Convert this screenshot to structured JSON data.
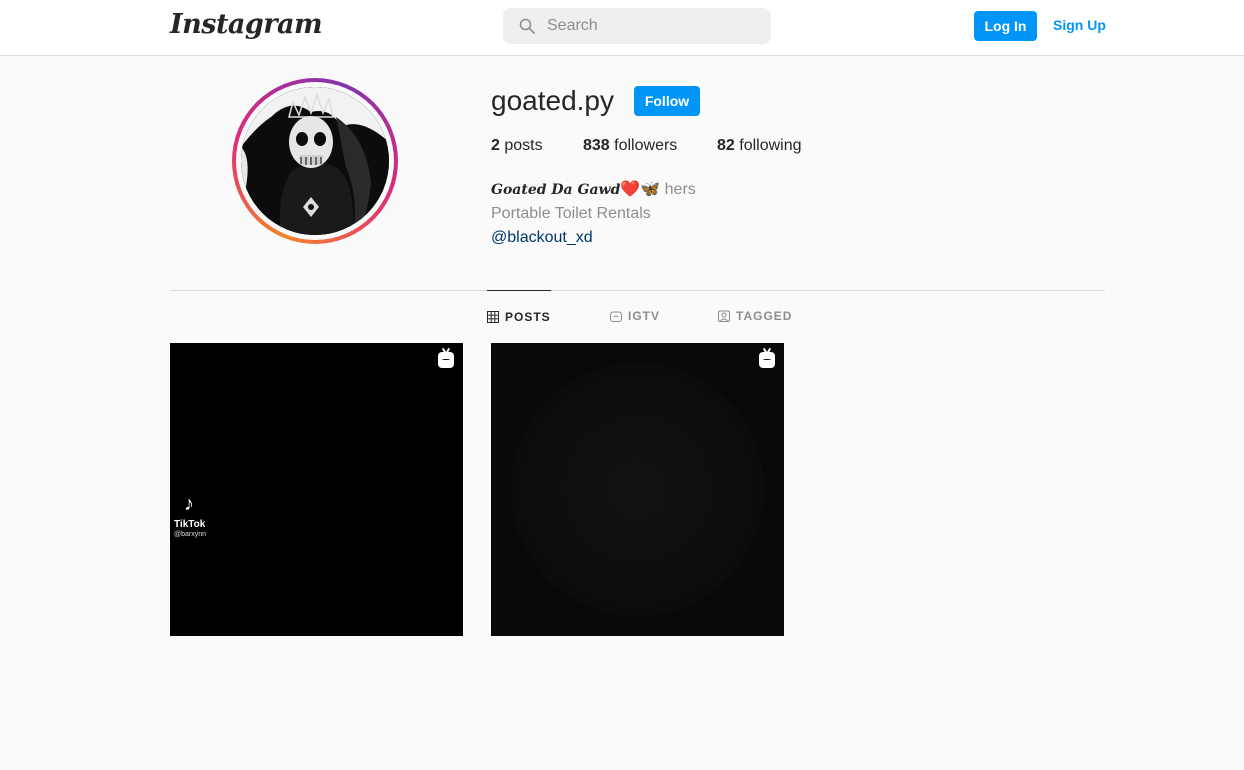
{
  "header": {
    "logo_text": "Instagram",
    "search_placeholder": "Search",
    "login_label": "Log In",
    "signup_label": "Sign Up"
  },
  "profile": {
    "username": "goated.py",
    "follow_label": "Follow",
    "stats": {
      "posts_count": "2",
      "posts_label": "posts",
      "followers_count": "838",
      "followers_label": "followers",
      "following_count": "82",
      "following_label": "following"
    },
    "bio": {
      "name": "Goated Da Gawd",
      "emoji": "❤️🦋",
      "pronouns": "hers",
      "category": "Portable Toilet Rentals",
      "link": "@blackout_xd"
    }
  },
  "tabs": [
    {
      "label": "POSTS",
      "icon": "grid-icon",
      "active": true
    },
    {
      "label": "IGTV",
      "icon": "igtv-icon",
      "active": false
    },
    {
      "label": "TAGGED",
      "icon": "tagged-icon",
      "active": false
    }
  ],
  "posts": [
    {
      "type": "igtv",
      "overlay_brand": "TikTok",
      "overlay_user": "@barxynn"
    },
    {
      "type": "igtv"
    }
  ],
  "colors": {
    "accent": "#0095f6",
    "link": "#00376b",
    "muted": "#8e8e8e",
    "text": "#262626",
    "background": "#fafafa",
    "border": "#dbdbdb"
  }
}
